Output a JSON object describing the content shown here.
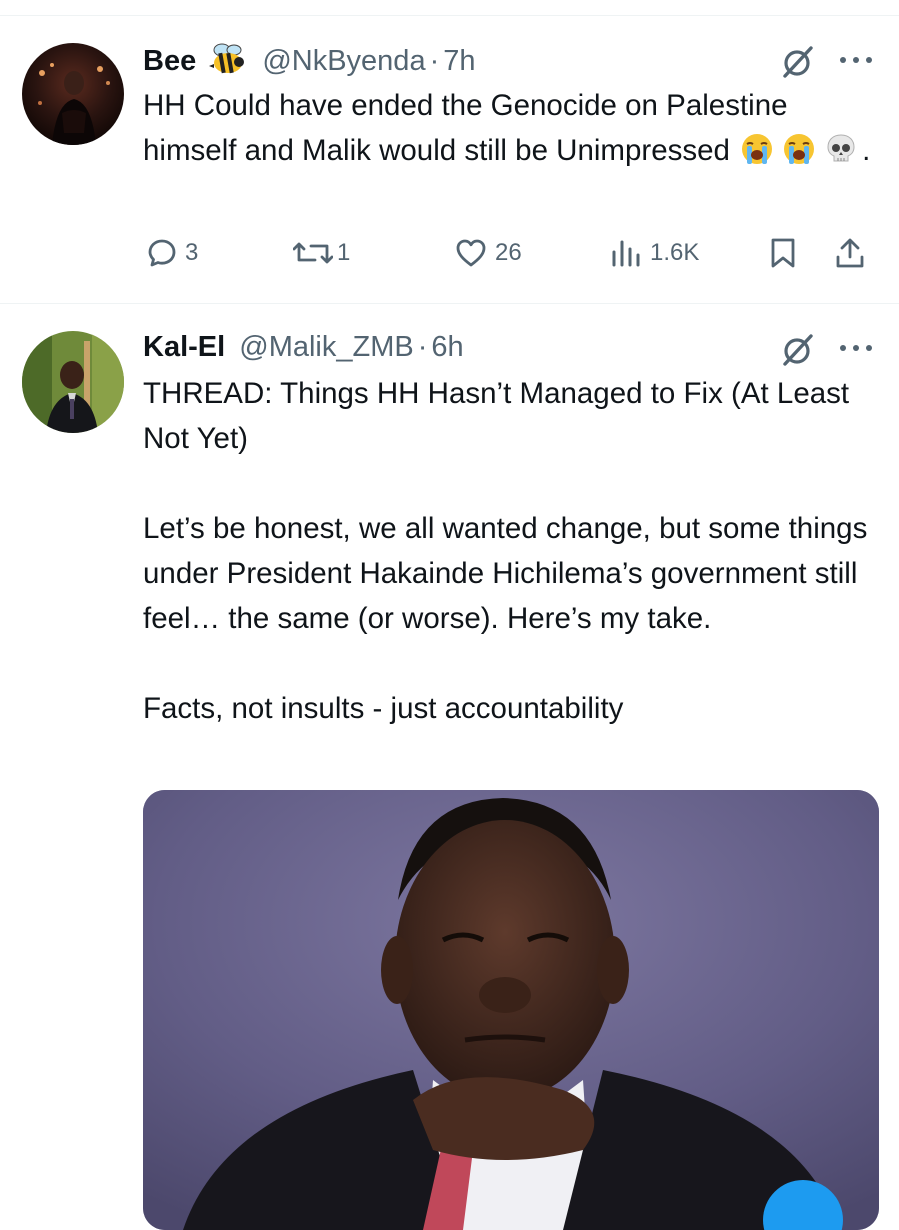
{
  "tweets": [
    {
      "name": "Bee",
      "handle": "@NkByenda",
      "separator": "·",
      "time": "7h",
      "text": "HH Could have ended the Genocide on Palestine himself and Malik would still be Unimpressed",
      "text_suffix": ".",
      "emoji_names": [
        "loudly-crying-face",
        "loudly-crying-face",
        "skull"
      ],
      "name_emoji": "honeybee",
      "replies": "3",
      "reposts": "1",
      "likes": "26",
      "views": "1.6K"
    },
    {
      "name": "Kal-El",
      "handle": "@Malik_ZMB",
      "separator": "·",
      "time": "6h",
      "paragraphs": [
        "THREAD: Things HH Hasn’t Managed to Fix (At Least Not Yet)",
        "Let’s be honest, we all wanted change, but some things under President Hakainde Hichilema’s government still feel… the same (or worse). Here’s my take.",
        "Facts, not insults - just accountability"
      ],
      "media_description": "photo"
    }
  ],
  "colors": {
    "text": "#0f1419",
    "secondary": "#536471",
    "divider": "#eff3f4",
    "accent": "#1d9bf0"
  }
}
